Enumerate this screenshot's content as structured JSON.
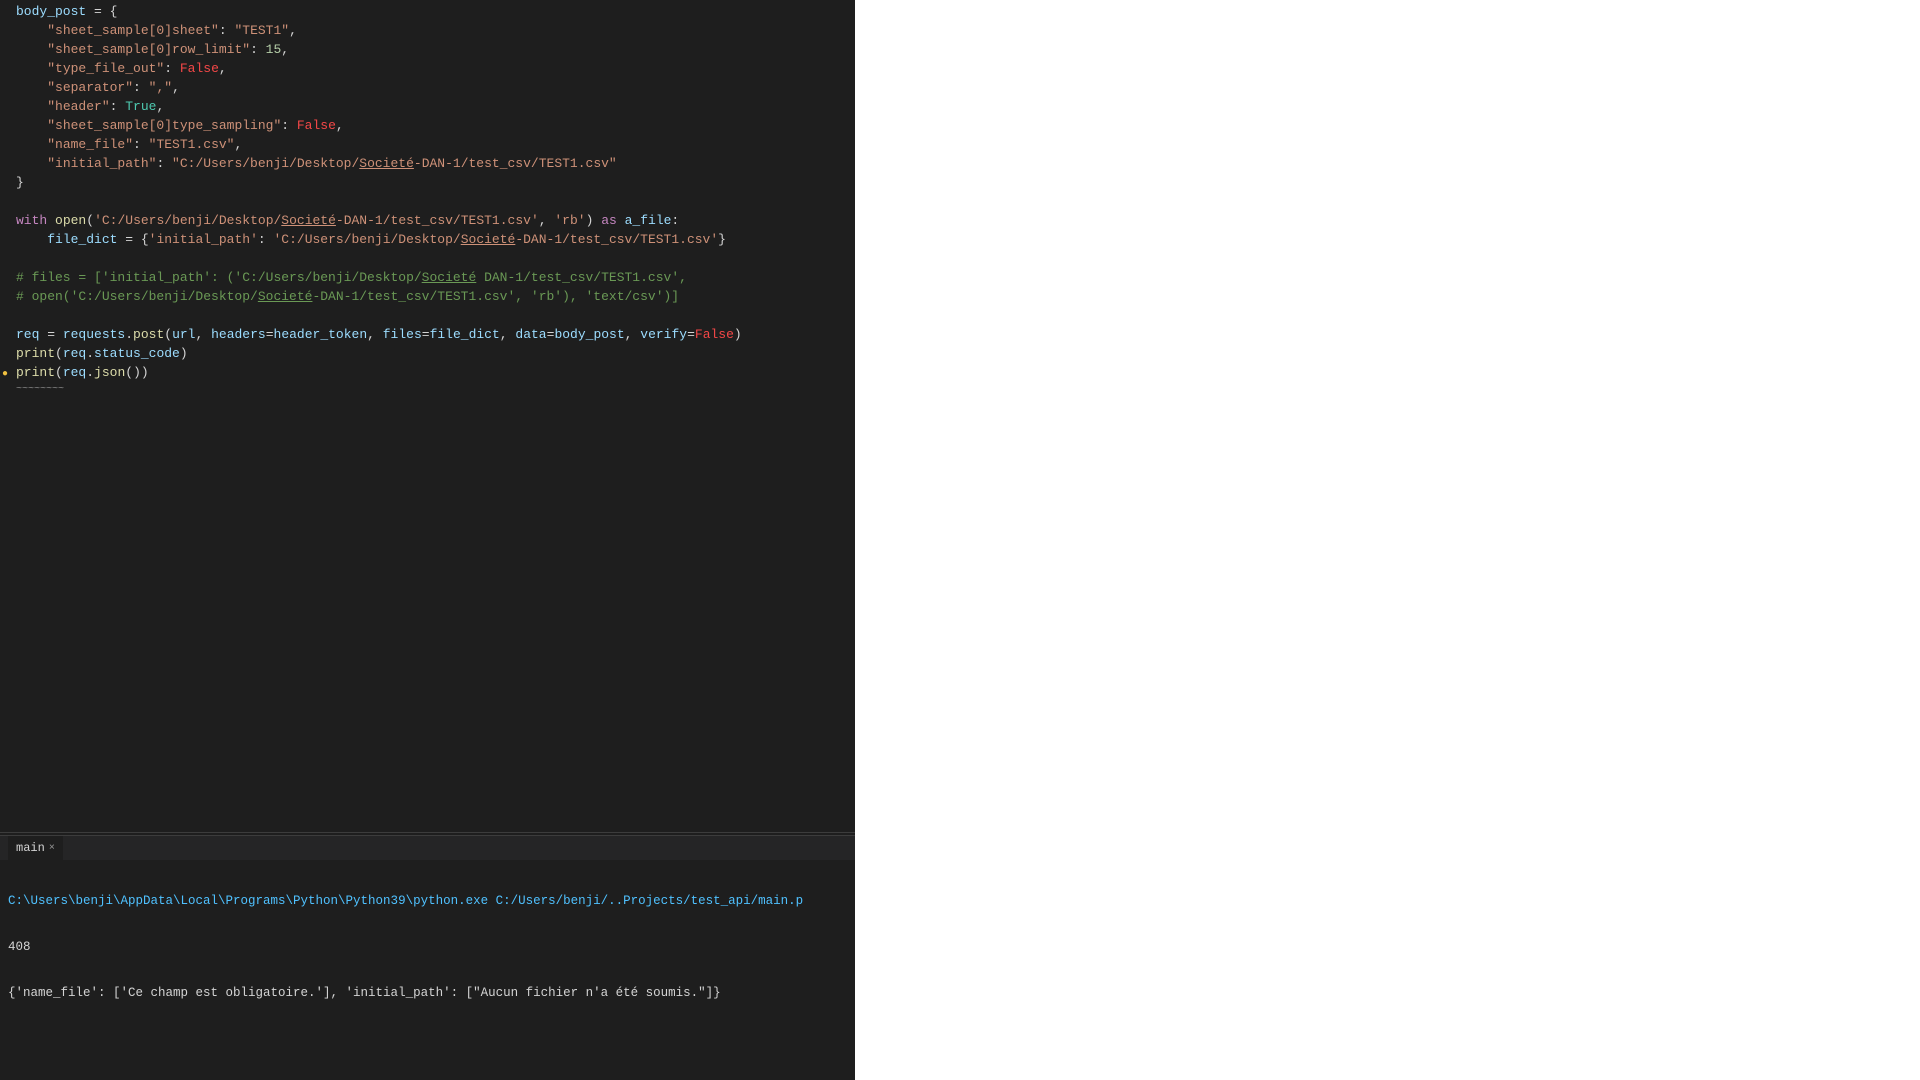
{
  "editor": {
    "lines": [
      {
        "id": "line1",
        "content": "body_post = {",
        "hasDot": false
      },
      {
        "id": "line2",
        "content": "    \"sheet_sample[0]sheet\": \"TEST1\",",
        "hasDot": false
      },
      {
        "id": "line3",
        "content": "    \"sheet_sample[0]row_limit\": 15,",
        "hasDot": false
      },
      {
        "id": "line4",
        "content": "    \"type_file_out\": False,",
        "hasDot": false
      },
      {
        "id": "line5",
        "content": "    \"separator\": \",\",",
        "hasDot": false
      },
      {
        "id": "line6",
        "content": "    \"header\": True,",
        "hasDot": false
      },
      {
        "id": "line7",
        "content": "    \"sheet_sample[0]type_sampling\": False,",
        "hasDot": false
      },
      {
        "id": "line8",
        "content": "    \"name_file\": \"TEST1.csv\",",
        "hasDot": false
      },
      {
        "id": "line9",
        "content": "    \"initial_path\": \"C:/Users/benji/Desktop/Societe-DAN-1/test_csv/TEST1.csv\"",
        "hasDot": false
      },
      {
        "id": "line10",
        "content": "}",
        "hasDot": false
      },
      {
        "id": "line11",
        "content": "",
        "hasDot": false
      },
      {
        "id": "line12",
        "content": "with open('C:/Users/benji/Desktop/Societe-DAN-1/test_csv/TEST1.csv', 'rb') as a_file:",
        "hasDot": false
      },
      {
        "id": "line13",
        "content": "    file_dict = {'initial_path': 'C:/Users/benji/Desktop/Societe-DAN-1/test_csv/TEST1.csv'}",
        "hasDot": false
      },
      {
        "id": "line14",
        "content": "",
        "hasDot": false
      },
      {
        "id": "line15",
        "content": "# files = ['initial_path': ('C:/Users/benji/Desktop/Societe DAN-1/test_csv/TEST1.csv',",
        "hasDot": false
      },
      {
        "id": "line16",
        "content": "# open('C:/Users/benji/Desktop/Societe-DAN-1/test_csv/TEST1.csv', 'rb'), 'text/csv')]",
        "hasDot": false
      },
      {
        "id": "line17",
        "content": "",
        "hasDot": false
      },
      {
        "id": "line18",
        "content": "req = requests.post(url, headers=header_token, files=file_dict, data=body_post, verify=False)",
        "hasDot": false
      },
      {
        "id": "line19",
        "content": "print(req.status_code)",
        "hasDot": false
      },
      {
        "id": "line20",
        "content": "print(req.json())",
        "hasDot": true
      }
    ]
  },
  "terminal": {
    "tab_label": "main",
    "tab_close": "×",
    "output_lines": [
      "C:\\Users\\benji\\AppData\\Local\\Programs\\Python\\Python39\\python.exe C:/Users/benji/..Projects/test_api/main.p",
      "408",
      "{'name_file': ['Ce champ est obligatoire.'], 'initial_path': [\"Aucun fichier n'a été soumis.\"]}"
    ]
  }
}
